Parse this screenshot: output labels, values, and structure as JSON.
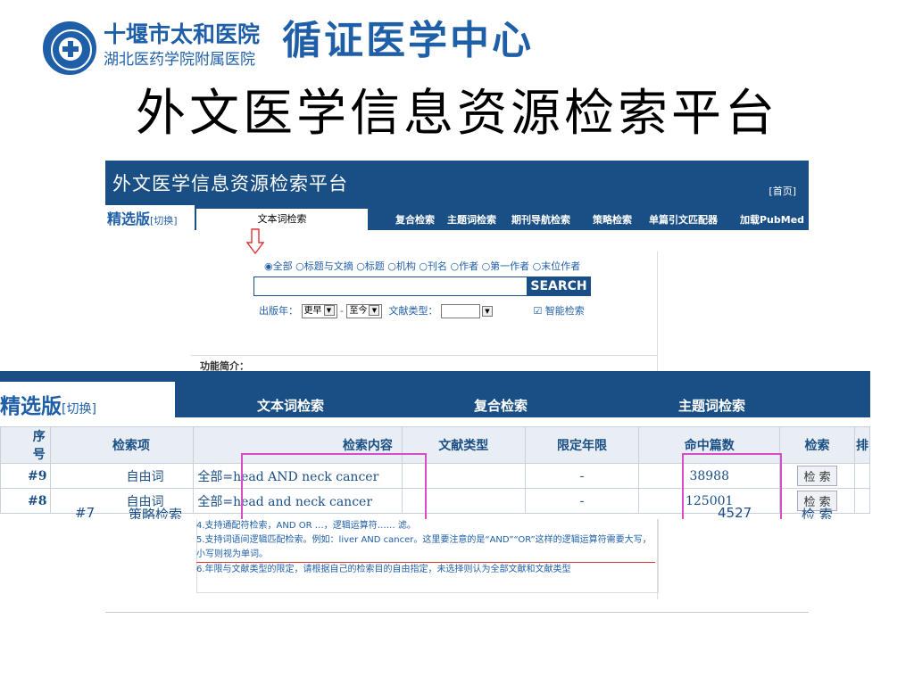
{
  "header": {
    "hospital_name": "十堰市太和医院",
    "hospital_sub": "湖北医药学院附属医院",
    "center_name": "循证医学中心",
    "slide_title": "外文医学信息资源检索平台",
    "logo_icon": "hospital-emblem-icon"
  },
  "colors": {
    "brand": "#1f5fa8",
    "nav": "#1a4f85",
    "highlight": "#d44ec6"
  },
  "shot1": {
    "platform_title": "外文医学信息资源检索平台",
    "home_link": "[首页]",
    "edition": "精选版",
    "switch": "[切换]",
    "tabs": [
      "文本词检索",
      "复合检索",
      "主题词检索",
      "期刊导航检索",
      "策略检索",
      "单篇引文匹配器",
      "加载PubMed"
    ],
    "radios": "◉全部 ○标题与文摘 ○标题 ○机构 ○刊名 ○作者 ○第一作者 ○末位作者",
    "search_button": "SEARCH",
    "year_label": "出版年：",
    "year_from": "更早",
    "dash": "-",
    "year_to": "至今",
    "doctype_label": "文献类型：",
    "smart_search": "☑ 智能检索",
    "feature_intro": "功能简介："
  },
  "shot2": {
    "edition": "精选版",
    "switch": "[切换]",
    "tabs": [
      "文本词检索",
      "复合检索",
      "主题词检索"
    ],
    "columns": [
      "序号",
      "检索项",
      "检索内容",
      "文献类型",
      "限定年限",
      "命中篇数",
      "检索",
      "排"
    ],
    "rows": [
      {
        "no": "#9",
        "field": "自由词",
        "content": "全部=head AND neck cancer",
        "doctype": "",
        "years": "-",
        "hits": "38988",
        "action": "检 索"
      },
      {
        "no": "#8",
        "field": "自由词",
        "content": "全部=head and neck cancer",
        "doctype": "",
        "years": "-",
        "hits": "125001",
        "action": "检 索"
      }
    ],
    "partial_row": {
      "no": "#7",
      "field": "策略检索",
      "hits": "4527",
      "action": "检 索"
    }
  },
  "notes": {
    "line1": "4.支持通配符检索，AND OR …，逻辑运算符…… 滤。",
    "line2": "5.支持词语间逻辑匹配检索。例如：liver AND cancer。这里要注意的是“AND”“OR”这样的逻辑运算符需要大写，小写则视为单词。",
    "line3": "6.年限与文献类型的限定，请根据自己的检索目的自由指定，未选择则认为全部文献和文献类型"
  }
}
